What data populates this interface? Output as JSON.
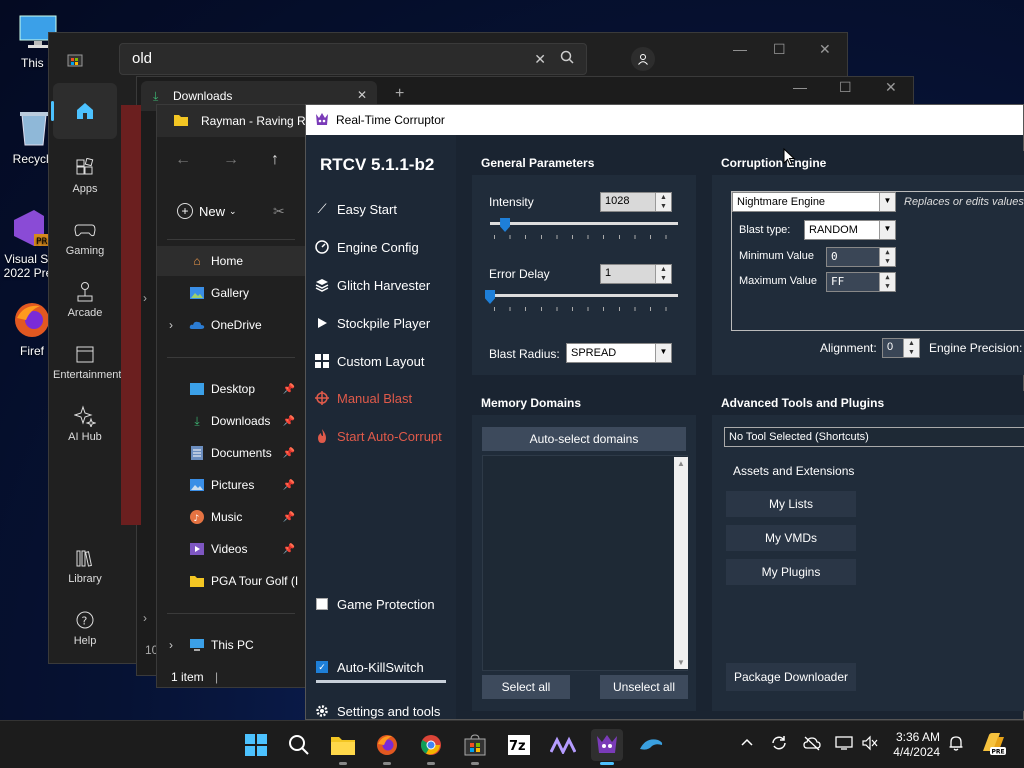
{
  "desktop": {
    "icons": [
      {
        "label": "This P"
      },
      {
        "label": "Recycle"
      },
      {
        "label": "Visual St 2022 Pre"
      },
      {
        "label": "Firef"
      }
    ]
  },
  "store": {
    "search_value": "old",
    "sidebar": [
      {
        "label": ""
      },
      {
        "label": "Apps"
      },
      {
        "label": "Gaming"
      },
      {
        "label": "Arcade"
      },
      {
        "label": "Entertainment"
      },
      {
        "label": "AI Hub"
      },
      {
        "label": "Library"
      },
      {
        "label": "Help"
      }
    ],
    "left_fragment": "10"
  },
  "downloads": {
    "tab_label": "Downloads"
  },
  "explorer": {
    "title": "Rayman - Raving Ra",
    "new_label": "New",
    "items": [
      {
        "label": "Home"
      },
      {
        "label": "Gallery"
      },
      {
        "label": "OneDrive"
      },
      {
        "label": "Desktop"
      },
      {
        "label": "Downloads"
      },
      {
        "label": "Documents"
      },
      {
        "label": "Pictures"
      },
      {
        "label": "Music"
      },
      {
        "label": "Videos"
      },
      {
        "label": "PGA Tour Golf (I"
      },
      {
        "label": "This PC"
      }
    ],
    "status": "1 item"
  },
  "rtcv": {
    "title": "Real-Time Corruptor",
    "version": "RTCV 5.1.1-b2",
    "menu": [
      {
        "label": "Easy Start"
      },
      {
        "label": "Engine Config"
      },
      {
        "label": "Glitch Harvester"
      },
      {
        "label": "Stockpile Player"
      },
      {
        "label": "Custom Layout"
      },
      {
        "label": "Manual Blast"
      },
      {
        "label": "Start Auto-Corrupt"
      }
    ],
    "game_protection": "Game Protection",
    "auto_killswitch": "Auto-KillSwitch",
    "settings": "Settings and tools",
    "general": {
      "header": "General Parameters",
      "intensity_label": "Intensity",
      "intensity_value": "1028",
      "intensity_level": 0.08,
      "error_delay_label": "Error Delay",
      "error_delay_value": "1",
      "error_delay_level": 0.0,
      "blast_radius_label": "Blast Radius:",
      "blast_radius_value": "SPREAD"
    },
    "engine": {
      "header": "Corruption Engine",
      "engine_value": "Nightmare Engine",
      "engine_desc": "Replaces or edits values",
      "blast_type_label": "Blast type:",
      "blast_type_value": "RANDOM",
      "min_label": "Minimum Value",
      "min_value": "0",
      "max_label": "Maximum Value",
      "max_value": "FF",
      "alignment_label": "Alignment:",
      "alignment_value": "0",
      "precision_label": "Engine Precision:"
    },
    "memory": {
      "header": "Memory Domains",
      "auto_select": "Auto-select domains",
      "select_all": "Select all",
      "unselect_all": "Unselect all"
    },
    "advanced": {
      "header": "Advanced Tools and Plugins",
      "tool_select": "No Tool Selected (Shortcuts)",
      "assets_label": "Assets and Extensions",
      "my_lists": "My Lists",
      "my_vmds": "My VMDs",
      "my_plugins": "My Plugins",
      "package_downloader": "Package Downloader"
    }
  },
  "taskbar": {
    "time": "3:36 AM",
    "date": "4/4/2024",
    "accent": "#4cc2ff"
  }
}
